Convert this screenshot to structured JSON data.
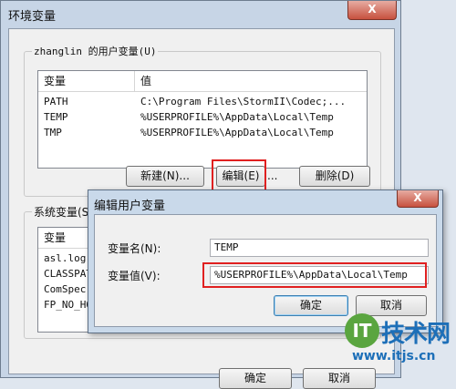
{
  "window": {
    "title": "环境变量",
    "close_glyph": "X"
  },
  "user_vars": {
    "group_title": "zhanglin 的用户变量(U)",
    "col_var": "变量",
    "col_val": "值",
    "rows": [
      {
        "name": "PATH",
        "value": "C:\\Program Files\\StormII\\Codec;..."
      },
      {
        "name": "TEMP",
        "value": "%USERPROFILE%\\AppData\\Local\\Temp"
      },
      {
        "name": "TMP",
        "value": "%USERPROFILE%\\AppData\\Local\\Temp"
      }
    ],
    "new_label": "新建(N)...",
    "edit_label": "编辑(E)",
    "edit_suffix": "...",
    "delete_label": "删除(D)"
  },
  "system_vars": {
    "group_title": "系统变量(S",
    "col_var": "变量",
    "rows": [
      {
        "name": "asl.log"
      },
      {
        "name": "CLASSPATH"
      },
      {
        "name": "ComSpec"
      },
      {
        "name": "FP_NO_HOST"
      }
    ]
  },
  "outer_buttons": {
    "ok_label": "确定",
    "cancel_label": "取消"
  },
  "dialog": {
    "title": "编辑用户变量",
    "close_glyph": "X",
    "name_label": "变量名(N):",
    "name_value": "TEMP",
    "value_label": "变量值(V):",
    "value_value": "%USERPROFILE%\\AppData\\Local\\Temp",
    "ok_label": "确定",
    "cancel_label": "取消"
  },
  "watermark": {
    "logo": "IT",
    "name": "技术网",
    "url": "www.itjs.cn"
  }
}
